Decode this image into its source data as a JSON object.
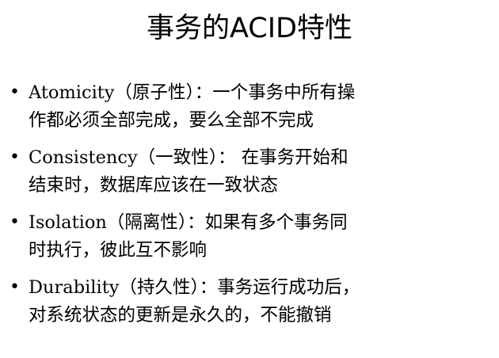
{
  "slide": {
    "title": "事务的ACID特性",
    "bullet_symbol": "•",
    "bullets": [
      {
        "line1": "Atomicity（原子性）：一个事务中所有操",
        "line2": "作都必须全部完成，要么全部不完成"
      },
      {
        "line1": "Consistency（一致性）： 在事务开始和",
        "line2": "结束时，数据库应该在一致状态"
      },
      {
        "line1": "Isolation（隔离性）：如果有多个事务同",
        "line2": "时执行，彼此互不影响"
      },
      {
        "line1": "Durability（持久性）：事务运行成功后，",
        "line2": "对系统状态的更新是永久的，不能撤销"
      }
    ]
  }
}
